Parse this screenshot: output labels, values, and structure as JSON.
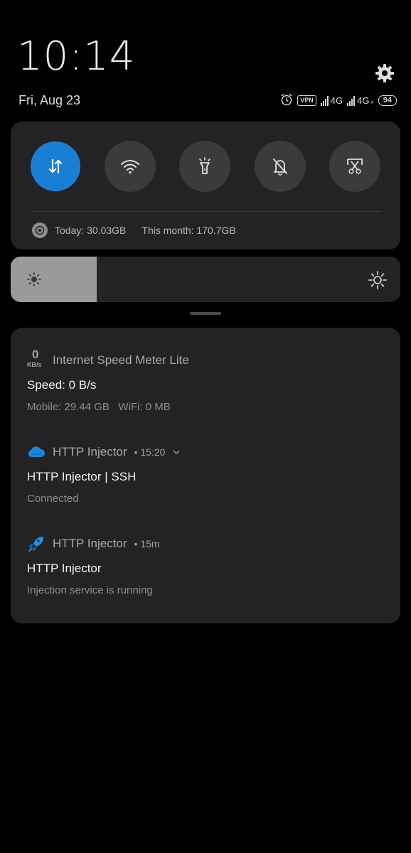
{
  "status": {
    "time": "10:14",
    "date": "Fri, Aug 23",
    "vpn": "VPN",
    "net1": "4G",
    "net2": "4G",
    "net2_sup": "+",
    "battery": "94"
  },
  "quick_settings": {
    "toggles": [
      {
        "name": "mobile-data",
        "icon": "data-arrows-icon",
        "active": true
      },
      {
        "name": "wifi",
        "icon": "wifi-icon",
        "active": false
      },
      {
        "name": "flashlight",
        "icon": "flashlight-icon",
        "active": false
      },
      {
        "name": "mute",
        "icon": "bell-off-icon",
        "active": false
      },
      {
        "name": "screenshot",
        "icon": "scissors-icon",
        "active": false
      }
    ],
    "data_today": "Today: 30.03GB",
    "data_month": "This month: 170.7GB"
  },
  "brightness": {
    "level_percent": 22
  },
  "notifications": [
    {
      "app": "Internet Speed Meter Lite",
      "app_icon_value": "0",
      "app_icon_unit": "KB/s",
      "title": "Speed: 0 B/s",
      "body": "Mobile: 29.44 GB   WiFi: 0 MB"
    },
    {
      "app": "HTTP Injector",
      "meta": "• 15:20",
      "title": "HTTP Injector | SSH",
      "body": "Connected"
    },
    {
      "app": "HTTP Injector",
      "meta": "• 15m",
      "title": "HTTP Injector",
      "body": "Injection service is running"
    }
  ],
  "colors": {
    "accent": "#1a7fd4",
    "card": "#232325",
    "background": "#000000"
  }
}
